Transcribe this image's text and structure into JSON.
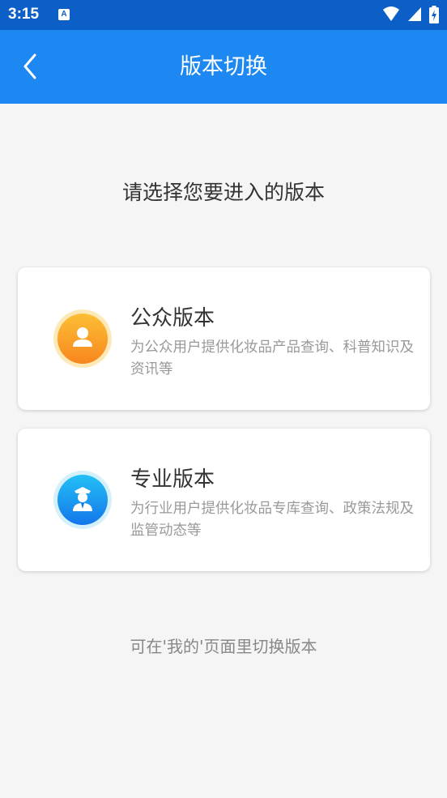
{
  "status_bar": {
    "time": "3:15",
    "notification_icon": "A"
  },
  "app_bar": {
    "title": "版本切换",
    "back_icon": "chevron-left-icon"
  },
  "prompt": "请选择您要进入的版本",
  "cards": [
    {
      "title": "公众版本",
      "description": "为公众用户提供化妆品产品查询、科普知识及资讯等",
      "icon": "person-icon",
      "icon_color": "#f9a12a"
    },
    {
      "title": "专业版本",
      "description": "为行业用户提供化妆品专库查询、政策法规及监管动态等",
      "icon": "officer-icon",
      "icon_color": "#1e88f2"
    }
  ],
  "footer_hint": "可在'我的'页面里切换版本",
  "colors": {
    "status_bar": "#0d5fc8",
    "app_bar": "#1e88f2",
    "background": "#f5f5f5"
  }
}
